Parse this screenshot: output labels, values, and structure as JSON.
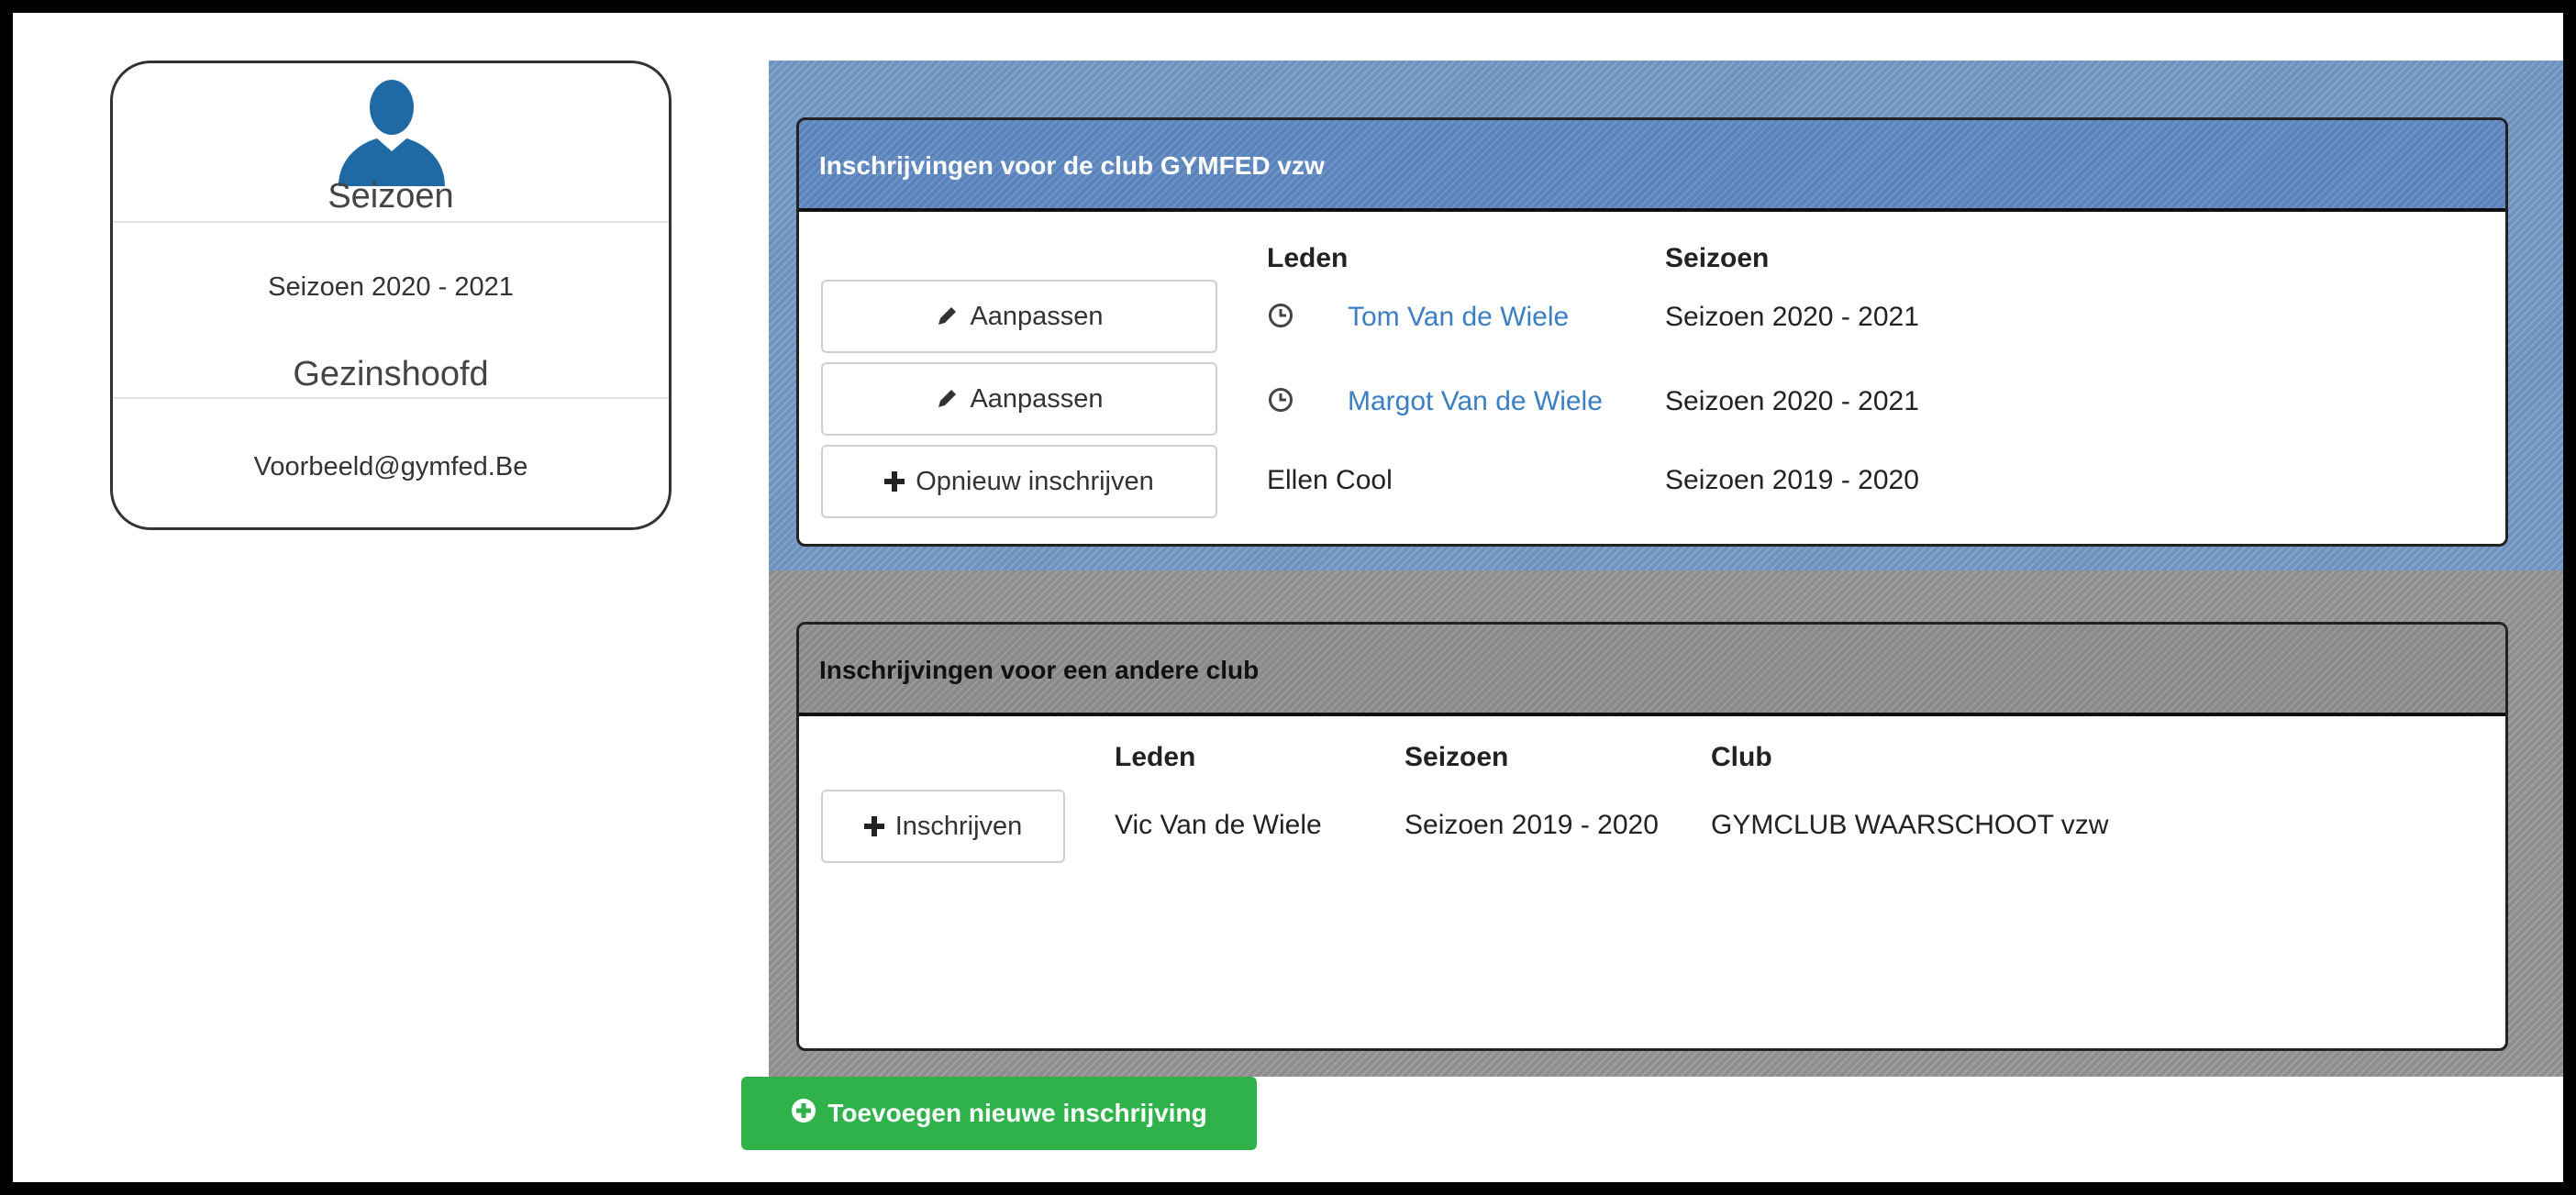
{
  "profile": {
    "title": "Seizoen",
    "season": "Seizoen 2020 - 2021",
    "role": "Gezinshoofd",
    "email": "Voorbeeld@gymfed.Be"
  },
  "club_section": {
    "heading": "Inschrijvingen voor de club GYMFED vzw",
    "columns": {
      "members": "Leden",
      "season": "Seizoen"
    },
    "rows": [
      {
        "action": "Aanpassen",
        "action_icon": "pencil-icon",
        "status_icon": "clock-icon",
        "member": "Tom Van de Wiele",
        "season": "Seizoen 2020 - 2021"
      },
      {
        "action": "Aanpassen",
        "action_icon": "pencil-icon",
        "status_icon": "clock-icon",
        "member": "Margot Van de Wiele",
        "season": "Seizoen 2020 - 2021"
      },
      {
        "action": "Opnieuw inschrijven",
        "action_icon": "plus-icon",
        "member": "Ellen Cool",
        "season": "Seizoen 2019 - 2020"
      }
    ]
  },
  "other_section": {
    "heading": "Inschrijvingen voor een andere club",
    "columns": {
      "members": "Leden",
      "season": "Seizoen",
      "club": "Club"
    },
    "rows": [
      {
        "action": "Inschrijven",
        "action_icon": "plus-icon",
        "member": "Vic Van de Wiele",
        "season": "Seizoen 2019 - 2020",
        "club": "GYMCLUB WAARSCHOOT vzw"
      }
    ]
  },
  "add_button": {
    "label": "Toevoegen nieuwe inschrijving",
    "icon": "plus-circle-icon"
  },
  "colors": {
    "brand_blue": "#5b84bd",
    "link": "#3a7ec4",
    "success": "#2fb24a",
    "avatar": "#1f6aa5"
  }
}
